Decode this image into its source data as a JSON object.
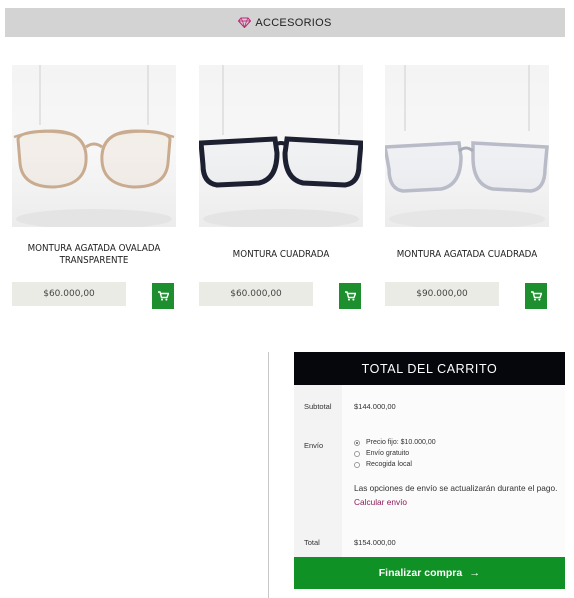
{
  "section": {
    "title": "ACCESORIOS",
    "icon": "diamond-icon"
  },
  "products": [
    {
      "name": "MONTURA AGATADA OVALADA TRANSPARENTE",
      "price": "$60.000,00",
      "frame_color": "#c9ab8f",
      "image_icon": "oval-glasses-image"
    },
    {
      "name": "MONTURA CUADRADA",
      "price": "$60.000,00",
      "frame_color": "#1c2030",
      "image_icon": "square-glasses-image"
    },
    {
      "name": "MONTURA AGATADA CUADRADA",
      "price": "$90.000,00",
      "frame_color": "#b9bcc8",
      "image_icon": "clear-square-glasses-image"
    }
  ],
  "cart_totals": {
    "title": "TOTAL DEL CARRITO",
    "subtotal_label": "Subtotal",
    "subtotal_value": "$144.000,00",
    "shipping_label": "Envío",
    "shipping_options": [
      {
        "label": "Precio fijo: $10.000,00",
        "selected": true
      },
      {
        "label": "Envío gratuito",
        "selected": false
      },
      {
        "label": "Recogida local",
        "selected": false
      }
    ],
    "shipping_note": "Las opciones de envío se actualizarán durante el pago.",
    "calculate_shipping_label": "Calcular envío",
    "total_label": "Total",
    "total_value": "$154.000,00",
    "checkout_label": "Finalizar compra",
    "checkout_arrow": "→"
  },
  "colors": {
    "accent_green": "#1e8f2e",
    "header_black": "#05070d",
    "link_purple": "#8b1c5a",
    "gem_pink": "#c2287a"
  }
}
